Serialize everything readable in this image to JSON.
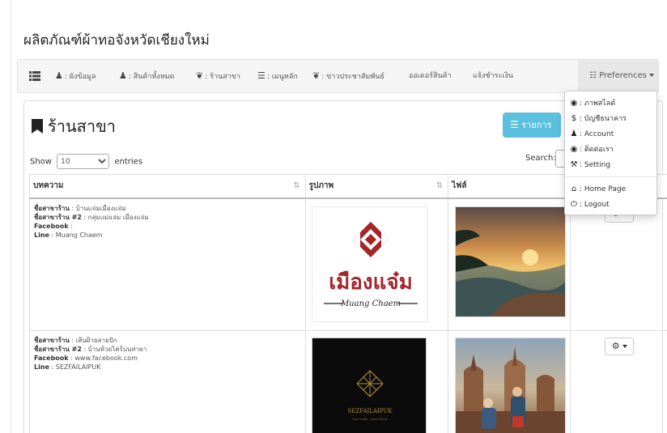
{
  "page": {
    "title": "ผลิตภัณฑ์ผ้าทอจังหวัดเชียงใหม่"
  },
  "navbar": {
    "menu_icon": "list-icon",
    "items": [
      {
        "icon": "user-tie-icon",
        "label": ": ผังข้อมูล"
      },
      {
        "icon": "user-tie-icon",
        "label": ": สินค้าทั้งหมด"
      },
      {
        "icon": "leaf-icon",
        "label": ": ร้านสาขา"
      },
      {
        "icon": "list-icon",
        "label": ": เมนูหลัก"
      },
      {
        "icon": "leaf-icon",
        "label": ": ข่าวประชาสัมพันธ์"
      },
      {
        "icon": "",
        "label": "ออเดอร์สินค้า"
      },
      {
        "icon": "",
        "label": "แจ้งชำระเงิน"
      }
    ],
    "preferences_label": "Preferences"
  },
  "dropdown": {
    "items": [
      {
        "icon": "eye-icon",
        "label": ": ภาพสไลด์"
      },
      {
        "icon": "dollar-icon",
        "label": ": บัญชีธนาคาร"
      },
      {
        "icon": "user-icon",
        "label": ": Account"
      },
      {
        "icon": "eye-icon",
        "label": ": ติดต่อเรา"
      },
      {
        "icon": "wrench-icon",
        "label": ": Setting"
      },
      {
        "icon": "home-icon",
        "label": ": Home Page"
      },
      {
        "icon": "power-icon",
        "label": ": Logout"
      }
    ]
  },
  "section": {
    "title": "ร้านสาขา",
    "list_button": "รายการ"
  },
  "datatable": {
    "show_label": "Show",
    "page_size": "10",
    "entries_label": "entries",
    "search_label": "Search:",
    "columns": [
      "บทความ",
      "รูปภาพ",
      "ไฟล์"
    ]
  },
  "rows": [
    {
      "lines": [
        {
          "key": "ชื่อสาขาร้าน",
          "value": " : บ้านแจ่มเมืองแจ่ม"
        },
        {
          "key": "ชื่อสาขาร้าน #2",
          "value": " : กลุ่มแม่แจ่ม เมืองแจ่ม"
        },
        {
          "key": "Facebook",
          "value": " : "
        },
        {
          "key": "Line",
          "value": " : Muang Chaem"
        }
      ],
      "logo_text": "เมืองแจ๋ม",
      "logo_subtext": "Muang Chaem"
    },
    {
      "lines": [
        {
          "key": "ชื่อสาขาร้าน",
          "value": " : เส้นฝ้ายลายปัก"
        },
        {
          "key": "ชื่อสาขาร้าน #2",
          "value": " : บ้านห้วยไคร้บนท่าผา"
        },
        {
          "key": "Facebook",
          "value": " : www.facebook.com"
        },
        {
          "key": "Line",
          "value": " : SEZFAILAIPUK"
        }
      ],
      "logo_text": "SEZFAILAIPUK",
      "logo_subtext": "Thai Crafts · Local Textile"
    }
  ],
  "colors": {
    "info_button": "#5bc0de",
    "logo_red": "#a3262b",
    "logo_gold": "#b08a3e"
  }
}
